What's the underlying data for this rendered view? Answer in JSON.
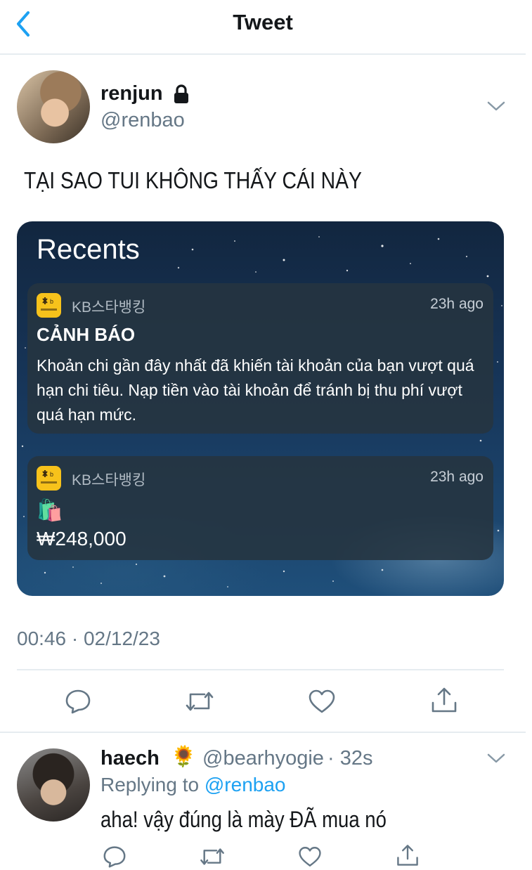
{
  "header": {
    "title": "Tweet"
  },
  "tweet": {
    "author_name": "renjun",
    "author_handle": "@renbao",
    "text": "TẠI SAO TUI KHÔNG THẤY CÁI NÀY",
    "timestamp": "00:46 · 02/12/23"
  },
  "media": {
    "heading": "Recents",
    "notifications": [
      {
        "app": "KB스타뱅킹",
        "time": "23h ago",
        "title": "CẢNH BÁO",
        "body": "Khoản chi gần đây nhất đã khiến tài khoản của bạn vượt quá hạn chi tiêu. Nạp tiền vào tài khoản để tránh bị thu phí vượt quá hạn mức."
      },
      {
        "app": "KB스타뱅킹",
        "time": "23h ago",
        "emoji": "🛍️",
        "amount": "₩248,000"
      }
    ]
  },
  "reply": {
    "author_name": "haech",
    "author_emoji": "🌻",
    "author_handle": "@bearhyogie",
    "time": "· 32s",
    "replying_label": "Replying to",
    "replying_handle": "@renbao",
    "text": "aha! vậy đúng là mày ĐÃ mua nó"
  },
  "colors": {
    "accent": "#1da1f2",
    "muted": "#657786",
    "divider": "#e6ecf0"
  },
  "icons": [
    "back-chevron-icon",
    "lock-icon",
    "chevron-down-icon",
    "reply-icon",
    "retweet-icon",
    "like-icon",
    "share-icon"
  ]
}
